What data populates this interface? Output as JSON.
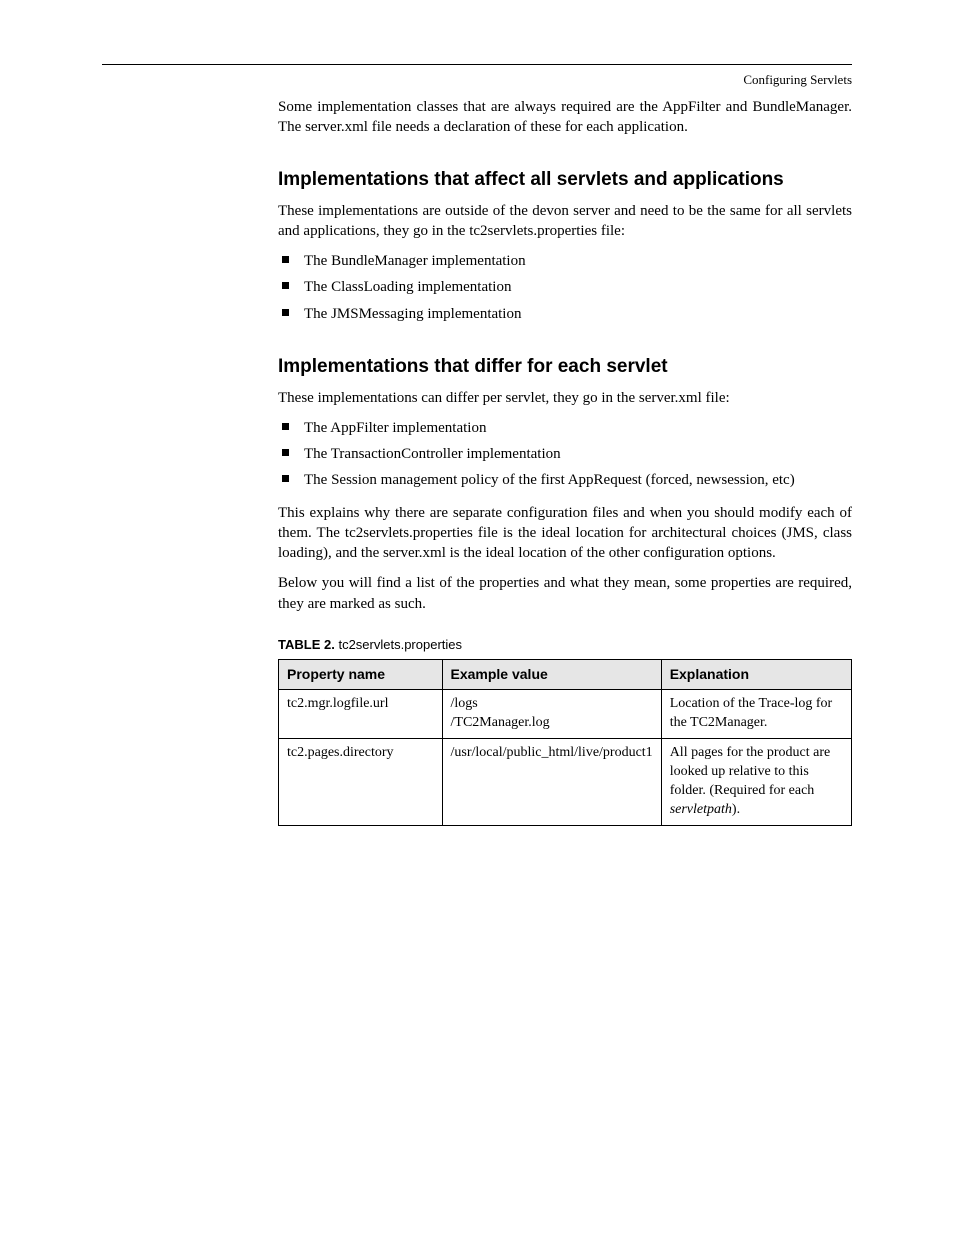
{
  "header": {
    "right": "Configuring Servlets"
  },
  "sections": {
    "implementationsIntro": "Some implementation classes that are always required are the AppFilter and BundleManager. The server.xml file needs a declaration of these for each application.",
    "implementationsHeading": "Implementations that affect all servlets and applications",
    "implementationsPara": "These implementations are outside of the devon server and need to be the same for all servlets and applications, they go in the tc2servlets.properties file:",
    "implList": [
      "The BundleManager implementation",
      "The ClassLoading implementation",
      "The JMSMessaging implementation"
    ],
    "servletsHeading": "Implementations that differ for each servlet",
    "servletsPara": "These implementations can differ per servlet, they go in the server.xml file:",
    "servletList": [
      "The AppFilter implementation",
      "The TransactionController implementation",
      "The Session management policy of the first AppRequest (forced, newsession, etc)"
    ],
    "architecturePara1": "This explains why there are separate configuration files and when you should modify each of them. The tc2servlets.properties file is the ideal location for architectural choices (JMS, class loading), and the server.xml is the ideal location of the other configuration options.",
    "architecturePara2": "Below you will find a list of the properties and what they mean, some properties are required, they are marked as such.",
    "table": {
      "captionLabel": "TABLE 2.",
      "captionText": "tc2servlets.properties",
      "headers": [
        "Property name",
        "Example value",
        "Explanation"
      ],
      "rows": [
        {
          "name": "tc2.mgr.logfile.url",
          "example": "/logs\n/TC2Manager.log",
          "explanation": "Location of the Trace-log for the TC2Manager."
        },
        {
          "name": "tc2.pages.directory",
          "example": "/usr/local/public_html/live/product1",
          "explanationPrefix": "All pages for the product are looked up relative to this folder. (Required for each ",
          "explanationEmph": "servletpath",
          "explanationSuffix": ")."
        }
      ]
    }
  }
}
